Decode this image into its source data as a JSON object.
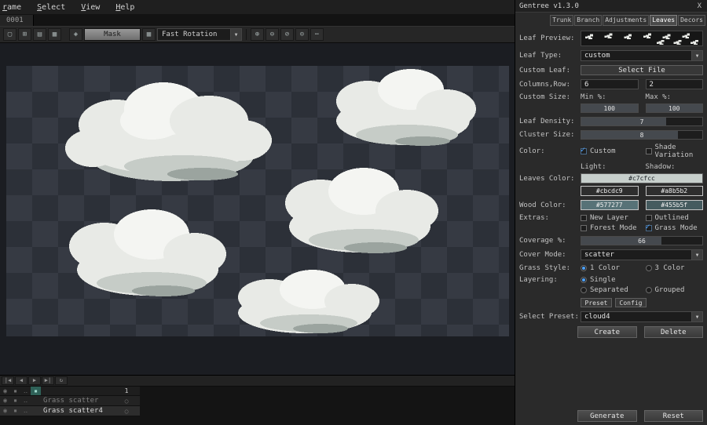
{
  "colors": {
    "accent": "#4da3ff",
    "leaves_light": "#c7cfcc",
    "leaf_hex_1": "#cbcdc9",
    "leaf_hex_2": "#a8b5b2",
    "wood_hex_1": "#577277",
    "wood_hex_2": "#455b5f",
    "checker_dark": "#2c3038",
    "checker_light": "#363a43",
    "cloud_white": "#eceee9",
    "cloud_shade": "#c6ccc7"
  },
  "icons": {
    "close": "X",
    "dropdown_arrow": "▼",
    "select_tool": "▢",
    "frames_tool": "⊞",
    "grid_tool": "▤",
    "tiles_tool": "▦",
    "sparkle_tool": "◈",
    "pattern_tool": "▦",
    "sym_plus": "⊕",
    "sym_minus": "⊖",
    "sym_slash": "⊘",
    "sym_dot": "⊙",
    "more": "⋯",
    "first_frame": "|◀",
    "prev_frame": "◀",
    "play": "▶",
    "last_frame": "▶|",
    "loop": "↻",
    "eye": "◉",
    "lock": "▪",
    "link": "‥",
    "onion": "▪",
    "cel_empty": "○"
  },
  "menubar": {
    "items": [
      "rame",
      "Select",
      "View",
      "Help"
    ]
  },
  "sprite_tab": {
    "label": "0001"
  },
  "toolbar": {
    "mask": "Mask",
    "rotation": "Fast Rotation"
  },
  "timeline": {
    "frame_header": "1",
    "layers": [
      {
        "name": "Grass scatter"
      },
      {
        "name": "Grass scatter4"
      }
    ]
  },
  "panel": {
    "title": "Gentree v1.3.0",
    "tabs": [
      "Trunk",
      "Branch",
      "Adjustments",
      "Leaves",
      "Decors"
    ],
    "active_tab": "Leaves",
    "leaf_preview_label": "Leaf Preview:",
    "leaf_type_label": "Leaf Type:",
    "leaf_type_value": "custom",
    "custom_leaf_label": "Custom Leaf:",
    "select_file_button": "Select File",
    "columns_row_label": "Columns,Row:",
    "columns_value": "6",
    "row_value": "2",
    "custom_size_label": "Custom Size:",
    "min_label": "Min %:",
    "max_label": "Max %:",
    "min_value": "100",
    "max_value": "100",
    "leaf_density_label": "Leaf Density:",
    "leaf_density_value": "7",
    "cluster_size_label": "Cluster Size:",
    "cluster_size_value": "8",
    "color_label": "Color:",
    "custom_checkbox": "Custom",
    "shade_variation_checkbox": "Shade Variation",
    "light_label": "Light:",
    "shadow_label": "Shadow:",
    "leaves_color_label": "Leaves Color:",
    "leaves_color_value": "#c7cfcc",
    "leaf_color_button_1": "#cbcdc9",
    "leaf_color_button_2": "#a8b5b2",
    "wood_color_label": "Wood Color:",
    "wood_color_button_1": "#577277",
    "wood_color_button_2": "#455b5f",
    "extras_label": "Extras:",
    "new_layer_checkbox": "New Layer",
    "outlined_checkbox": "Outlined",
    "forest_mode_checkbox": "Forest Mode",
    "grass_mode_checkbox": "Grass Mode",
    "coverage_label": "Coverage %:",
    "coverage_value": "66",
    "cover_mode_label": "Cover Mode:",
    "cover_mode_value": "scatter",
    "grass_style_label": "Grass Style:",
    "one_color_radio": "1 Color",
    "three_color_radio": "3 Color",
    "layering_label": "Layering:",
    "single_radio": "Single",
    "separated_radio": "Separated",
    "grouped_radio": "Grouped",
    "preset_button": "Preset",
    "config_button": "Config",
    "select_preset_label": "Select Preset:",
    "preset_value": "cloud4",
    "create_button": "Create",
    "delete_button": "Delete",
    "generate_button": "Generate",
    "reset_button": "Reset"
  }
}
